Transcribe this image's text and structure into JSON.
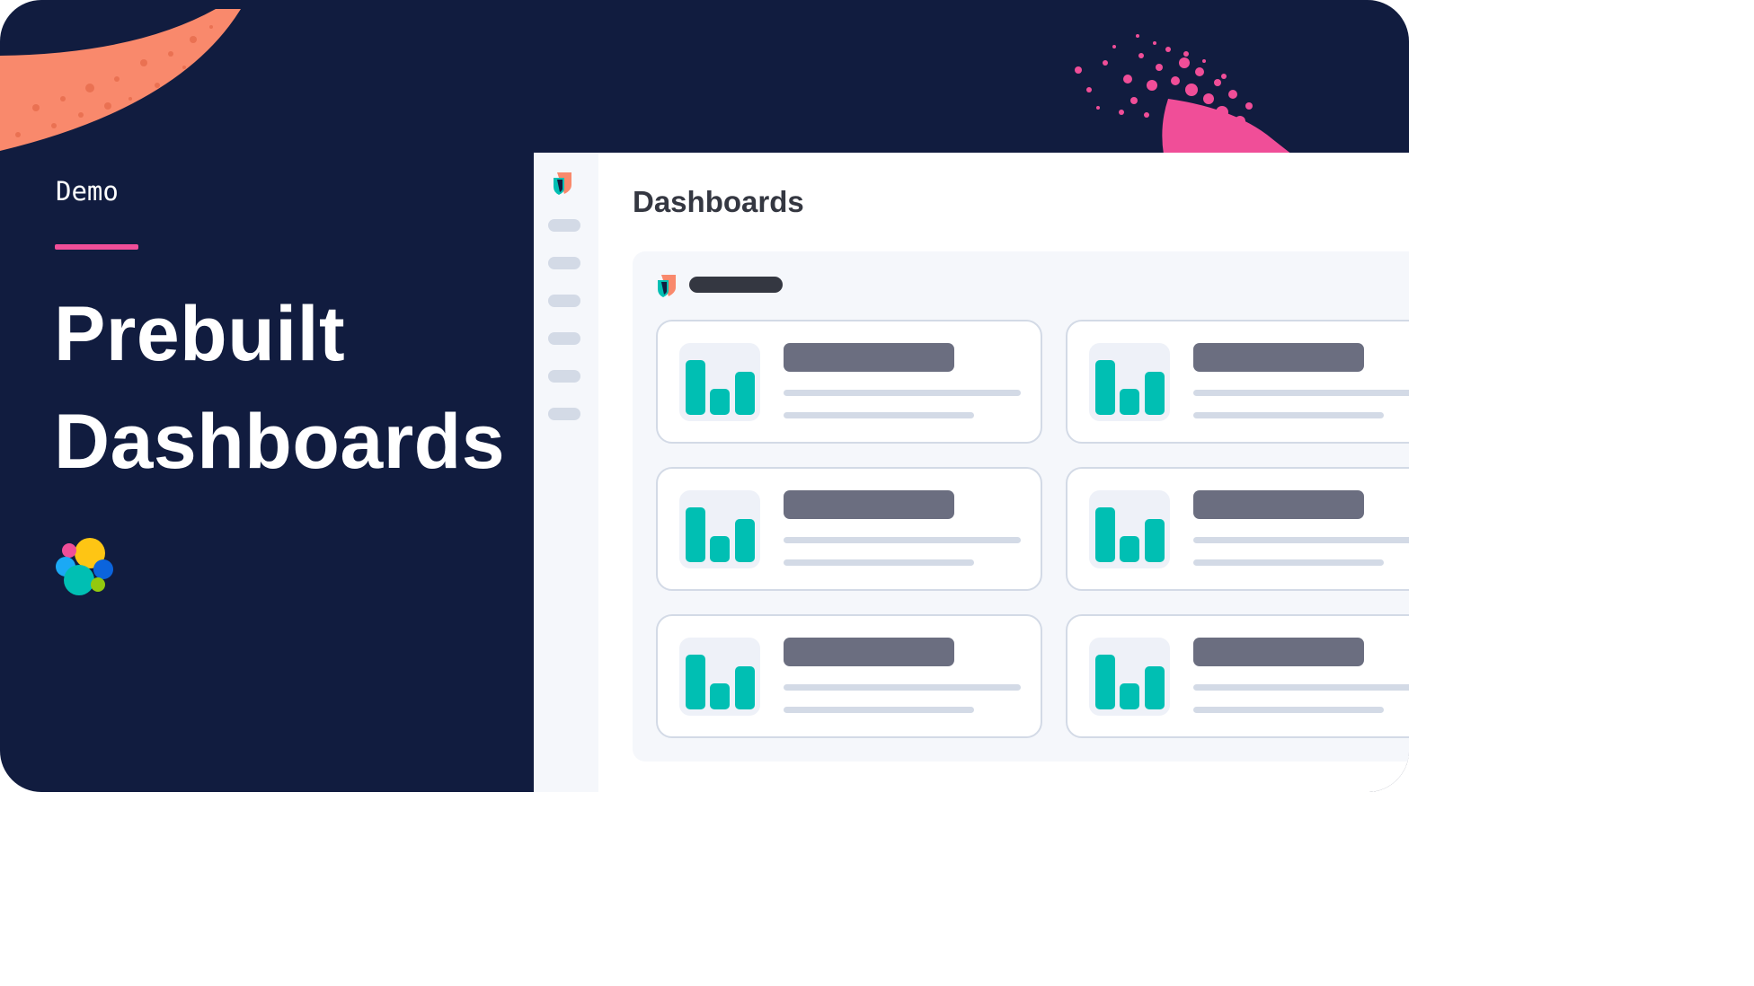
{
  "colors": {
    "background": "#111c3f",
    "accent_pink": "#f04e98",
    "accent_orange": "#f9896c",
    "teal": "#00bfb3",
    "panel": "#f5f7fb",
    "placeholder_dark": "#343741",
    "placeholder_grey": "#6b6e80",
    "placeholder_light": "#d3dae6"
  },
  "hero": {
    "eyebrow": "Demo",
    "title_line1": "Prebuilt",
    "title_line2": "Dashboards",
    "logo_icon": "elastic-logo-icon"
  },
  "app": {
    "logo_icon": "shield-logo-icon",
    "nav_item_count": 6,
    "page_title": "Dashboards",
    "tile_icon": "bar-chart-icon",
    "tile_count": 6
  }
}
